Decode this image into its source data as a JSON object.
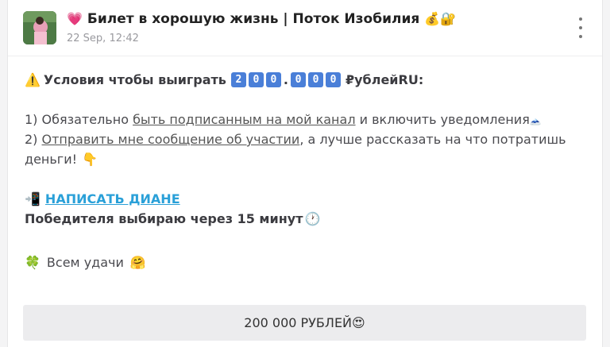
{
  "header": {
    "title_prefix_emoji": "💗",
    "title": "Билет в хорошую жизнь | Поток Изобилия",
    "title_suffix_emoji": "💰🔐",
    "date": "22 Sep, 12:42"
  },
  "body": {
    "line1_emoji": "⚠️",
    "line1_text": "Условия чтобы выиграть",
    "prize_digits": [
      "2",
      "0",
      "0",
      "0",
      "0",
      "0"
    ],
    "prize_separator": ".",
    "line1_suffix": "₽ублейRU:",
    "cond1_prefix": "1) Обязательно ",
    "cond1_link": "быть подписанным на мой канал",
    "cond1_suffix": " и включить уведомления",
    "cond1_emoji": "🗻",
    "cond2_prefix": "2) ",
    "cond2_link": "Отправить мне сообщение об участии",
    "cond2_suffix": ", а лучше рассказать на что потратишь",
    "cond2_line2": "деньги!",
    "cond2_emoji": "👇",
    "write_emoji": "📲",
    "write_link": "НАПИСАТЬ ДИАНЕ",
    "winner_text": "Победителя выбираю через 15 минут",
    "winner_emoji": "🕐",
    "luck_emoji": "🍀",
    "luck_text": "Всем удачи",
    "luck_suffix_emoji": "🤗"
  },
  "footer": {
    "button_label": "200 000 РУБЛЕЙ",
    "button_emoji": "😍"
  }
}
